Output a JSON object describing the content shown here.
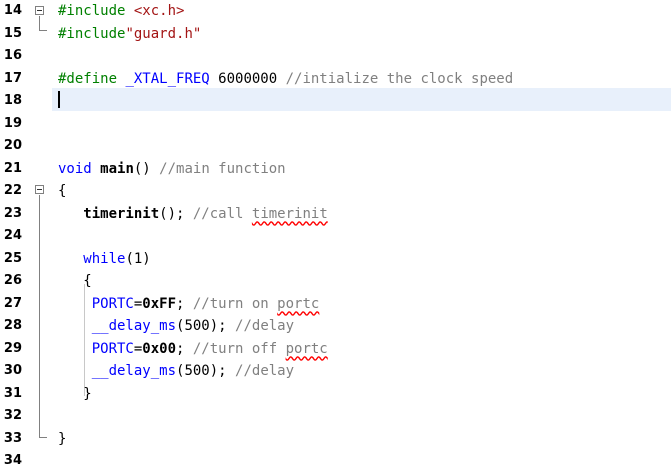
{
  "editor": {
    "lines": [
      {
        "num": "14",
        "segments": [
          {
            "t": "#include ",
            "c": "pre"
          },
          {
            "t": "<xc.h>",
            "c": "str"
          }
        ]
      },
      {
        "num": "15",
        "segments": [
          {
            "t": "#include",
            "c": "pre"
          },
          {
            "t": "\"guard.h\"",
            "c": "str"
          }
        ]
      },
      {
        "num": "16",
        "segments": []
      },
      {
        "num": "17",
        "segments": [
          {
            "t": "#define ",
            "c": "pre"
          },
          {
            "t": "_XTAL_FREQ",
            "c": "sym squig-no"
          },
          {
            "t": " 6000000 ",
            "c": ""
          },
          {
            "t": "//intialize the clock speed",
            "c": "cmt"
          }
        ]
      },
      {
        "num": "18",
        "segments": []
      },
      {
        "num": "19",
        "segments": []
      },
      {
        "num": "20",
        "segments": []
      },
      {
        "num": "21",
        "segments": [
          {
            "t": "void ",
            "c": "kw"
          },
          {
            "t": "main",
            "c": "bold"
          },
          {
            "t": "() ",
            "c": ""
          },
          {
            "t": "//main function",
            "c": "cmt"
          }
        ]
      },
      {
        "num": "22",
        "segments": [
          {
            "t": "{",
            "c": ""
          }
        ]
      },
      {
        "num": "23",
        "segments": [
          {
            "t": "   timerinit",
            "c": "bold"
          },
          {
            "t": "(); ",
            "c": ""
          },
          {
            "t": "//call ",
            "c": "cmt"
          },
          {
            "t": "timerinit",
            "c": "cmt squig"
          }
        ]
      },
      {
        "num": "24",
        "segments": []
      },
      {
        "num": "25",
        "segments": [
          {
            "t": "   while",
            "c": "kw"
          },
          {
            "t": "(1)",
            "c": ""
          }
        ]
      },
      {
        "num": "26",
        "segments": [
          {
            "t": "   {",
            "c": ""
          }
        ]
      },
      {
        "num": "27",
        "segments": [
          {
            "t": "    PORTC",
            "c": "sym"
          },
          {
            "t": "=",
            "c": ""
          },
          {
            "t": "0xFF",
            "c": "bold"
          },
          {
            "t": "; ",
            "c": ""
          },
          {
            "t": "//turn on ",
            "c": "cmt"
          },
          {
            "t": "portc",
            "c": "cmt squig"
          }
        ]
      },
      {
        "num": "28",
        "segments": [
          {
            "t": "    __delay_ms",
            "c": "sym"
          },
          {
            "t": "(500); ",
            "c": ""
          },
          {
            "t": "//delay",
            "c": "cmt"
          }
        ]
      },
      {
        "num": "29",
        "segments": [
          {
            "t": "    PORTC",
            "c": "sym"
          },
          {
            "t": "=",
            "c": ""
          },
          {
            "t": "0x00",
            "c": "bold"
          },
          {
            "t": "; ",
            "c": ""
          },
          {
            "t": "//turn off ",
            "c": "cmt"
          },
          {
            "t": "portc",
            "c": "cmt squig"
          }
        ]
      },
      {
        "num": "30",
        "segments": [
          {
            "t": "    __delay_ms",
            "c": "sym"
          },
          {
            "t": "(500); ",
            "c": ""
          },
          {
            "t": "//delay",
            "c": "cmt"
          }
        ]
      },
      {
        "num": "31",
        "segments": [
          {
            "t": "   }",
            "c": ""
          }
        ]
      },
      {
        "num": "32",
        "segments": []
      },
      {
        "num": "33",
        "segments": [
          {
            "t": "}",
            "c": ""
          }
        ]
      },
      {
        "num": "34",
        "segments": []
      }
    ],
    "current_line": "18"
  },
  "colors": {
    "keyword": "#0000ff",
    "preprocessor": "#008000",
    "string": "#a31515",
    "comment": "#808080",
    "current_line_bg": "#e8f0fb"
  }
}
